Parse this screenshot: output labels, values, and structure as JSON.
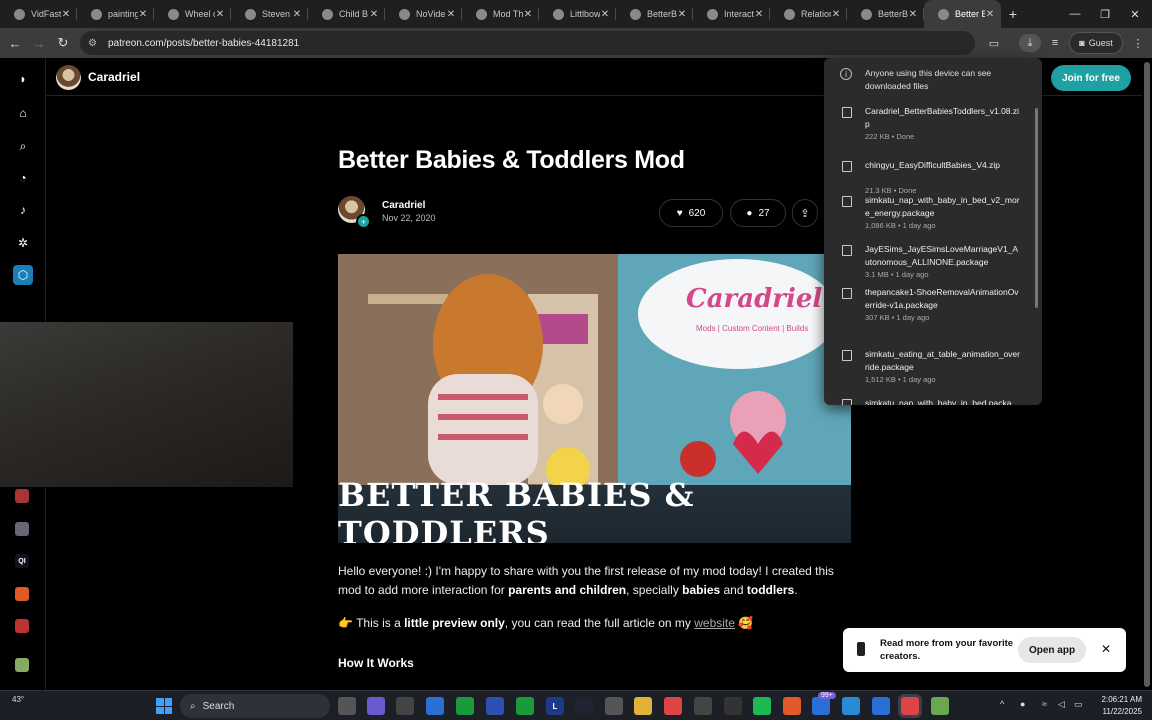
{
  "tabs": [
    {
      "title": "VidFast",
      "active": false
    },
    {
      "title": "painting",
      "active": false
    },
    {
      "title": "Wheel of",
      "active": false
    },
    {
      "title": "Steven",
      "active": false
    },
    {
      "title": "Child B",
      "active": false
    },
    {
      "title": "NoVide",
      "active": false
    },
    {
      "title": "Mod Th",
      "active": false
    },
    {
      "title": "Littlbow",
      "active": false
    },
    {
      "title": "BetterB",
      "active": false
    },
    {
      "title": "Interact",
      "active": false
    },
    {
      "title": "Relation",
      "active": false
    },
    {
      "title": "BetterB",
      "active": false
    },
    {
      "title": "Better B",
      "active": true
    }
  ],
  "address": {
    "url": "patreon.com/posts/better-babies-44181281"
  },
  "profile": {
    "label": "Guest"
  },
  "creator": {
    "name": "Caradriel",
    "join_label": "Join for free"
  },
  "post": {
    "title": "Better Babies & Toddlers Mod",
    "author": "Caradriel",
    "date": "Nov 22, 2020",
    "likes": "620",
    "comments": "27",
    "hero_logo": "Caradriel",
    "hero_sub": "Mods | Custom Content | Builds",
    "hero_banner": "BETTER BABIES & TODDLERS",
    "para1_a": "Hello everyone! :) I'm happy to share with you the first release of my mod today! I created this mod to add more interaction for ",
    "para1_b": "parents and children",
    "para1_c": ", specially ",
    "para1_d": "babies",
    "para1_e": " and ",
    "para1_f": "toddlers",
    "para1_g": ".",
    "para2_emoji": "👉",
    "para2_a": " This is a ",
    "para2_b": "little preview only",
    "para2_c": ", you can read the full article on my ",
    "para2_link": "website",
    "para2_end": " 🥰",
    "how_heading": "How It Works"
  },
  "downloads": {
    "note": "Anyone using this device can see downloaded files",
    "items": [
      {
        "name": "Caradriel_BetterBabiesToddlers_v1.08.zip",
        "meta": "222 KB • Done"
      },
      {
        "name": "chingyu_EasyDifficultBabies_V4.zip",
        "meta": "21.3 KB • Done"
      },
      {
        "name": "simkatu_nap_with_baby_in_bed_v2_more_energy.package",
        "meta": "1,086 KB • 1 day ago"
      },
      {
        "name": "JayESims_JayESimsLoveMarriageV1_Autonomous_ALLINONE.package",
        "meta": "3.1 MB • 1 day ago"
      },
      {
        "name": "thepancake1-ShoeRemovalAnimationOverride-v1a.package",
        "meta": "307 KB • 1 day ago"
      },
      {
        "name": "simkatu_eating_at_table_animation_override.package",
        "meta": "1,512 KB • 1 day ago"
      },
      {
        "name": "simkatu_nap_with_baby_in_bed.packa",
        "meta": ""
      }
    ]
  },
  "snackbar": {
    "text": "Read more from your favorite creators.",
    "open_label": "Open app"
  },
  "taskbar": {
    "weather": "43°",
    "search": "Search",
    "badge": "99+",
    "time": "2:06:21 AM",
    "date": "11/22/2025"
  },
  "colors": {
    "accent": "#1fa1a4",
    "page_bg": "#000000",
    "chrome": "#3c3c3c"
  }
}
